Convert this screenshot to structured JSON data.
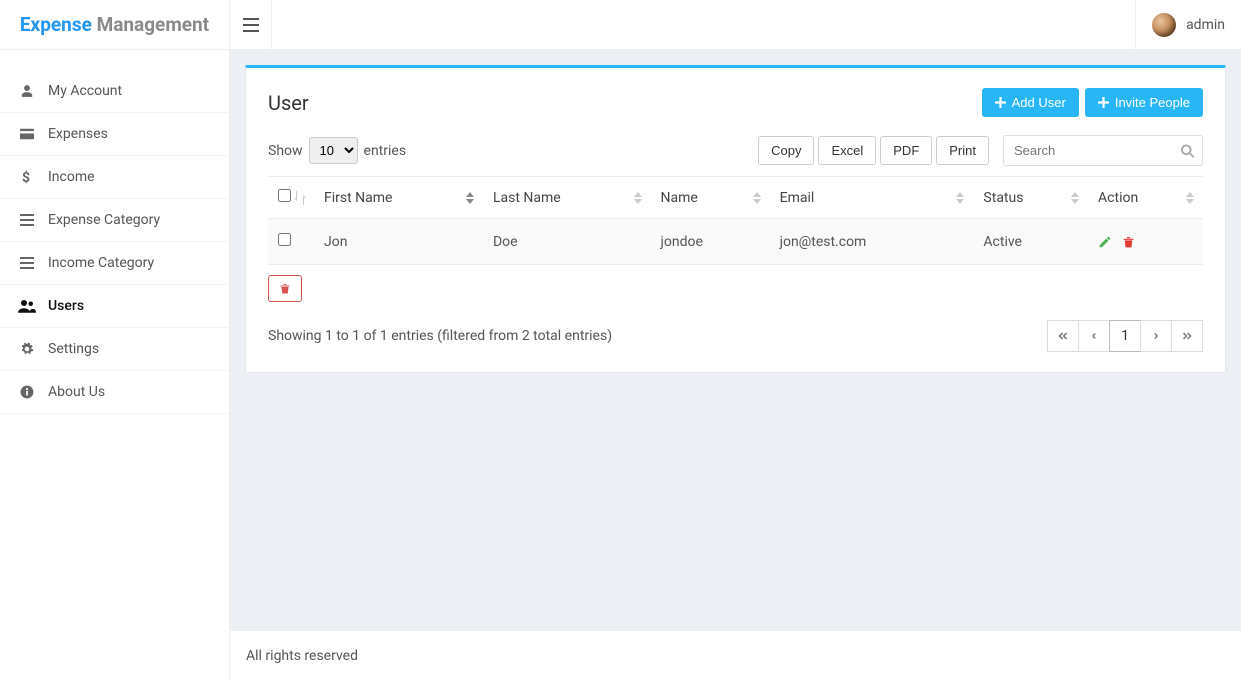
{
  "brand": {
    "word1": "Expense",
    "word2": "Management"
  },
  "header": {
    "user": "admin"
  },
  "sidebar": {
    "items": [
      {
        "label": "My Account"
      },
      {
        "label": "Expenses"
      },
      {
        "label": "Income"
      },
      {
        "label": "Expense Category"
      },
      {
        "label": "Income Category"
      },
      {
        "label": "Users"
      },
      {
        "label": "Settings"
      },
      {
        "label": "About Us"
      }
    ]
  },
  "panel": {
    "title": "User",
    "add_user": "Add User",
    "invite_people": "Invite People"
  },
  "length": {
    "show": "Show",
    "entries": "entries",
    "value": "10"
  },
  "export": {
    "copy": "Copy",
    "excel": "Excel",
    "pdf": "PDF",
    "print": "Print"
  },
  "search": {
    "placeholder": "Search"
  },
  "table": {
    "headers": {
      "first_name": "First Name",
      "last_name": "Last Name",
      "name": "Name",
      "email": "Email",
      "status": "Status",
      "action": "Action"
    },
    "rows": [
      {
        "first_name": "Jon",
        "last_name": "Doe",
        "name": "jondoe",
        "email": "jon@test.com",
        "status": "Active"
      }
    ]
  },
  "info": "Showing 1 to 1 of 1 entries (filtered from 2 total entries)",
  "pager": {
    "current": "1"
  },
  "footer": "All rights reserved"
}
